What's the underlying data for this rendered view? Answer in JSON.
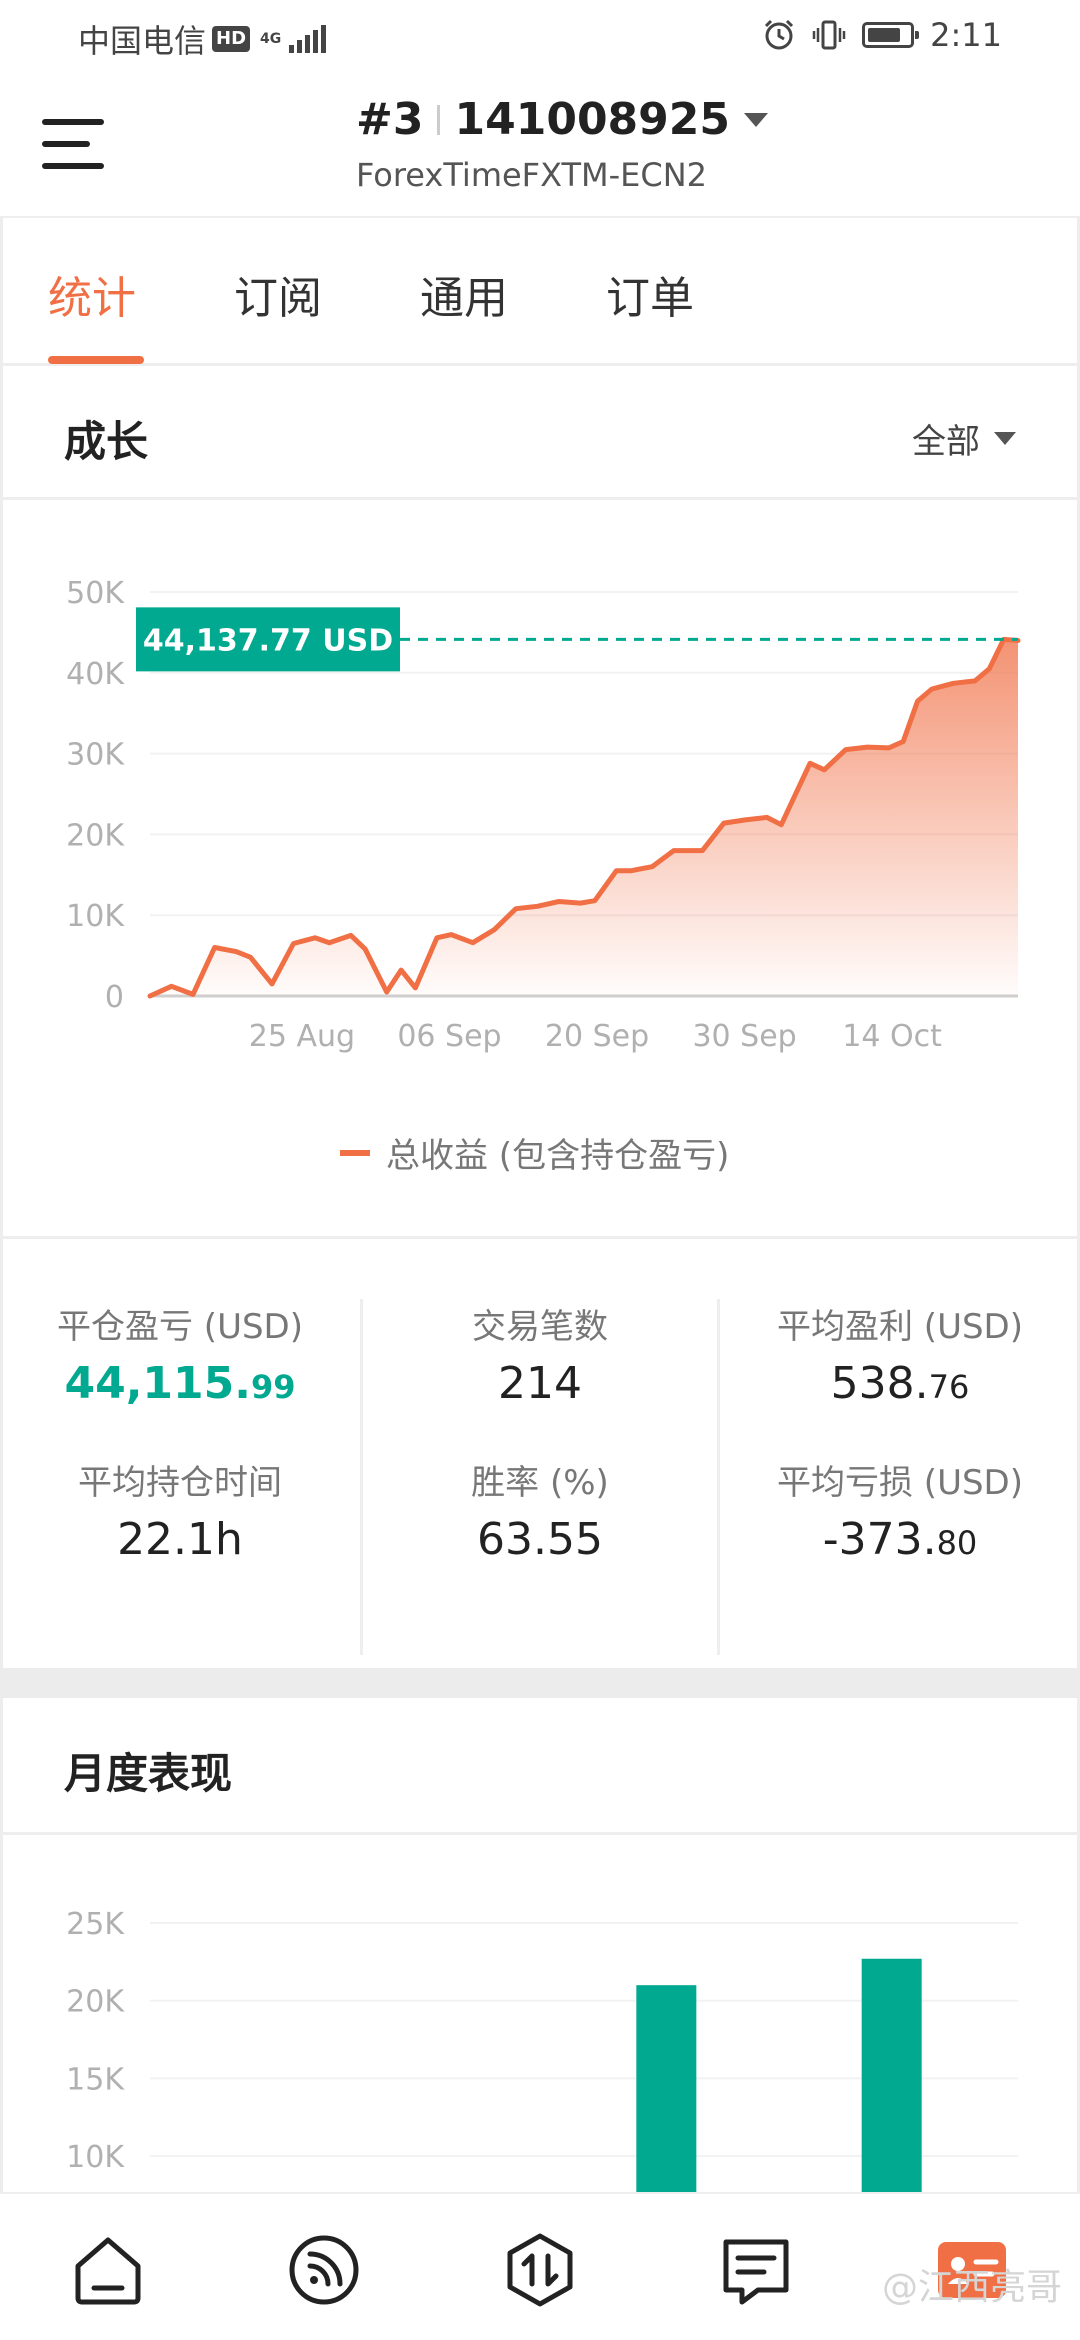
{
  "status_bar": {
    "carrier": "中国电信",
    "hd": "HD",
    "net": "4G",
    "time": "2:11",
    "battery_level": 0.8,
    "icons": [
      "alarm-icon",
      "vibrate-icon",
      "battery-icon"
    ]
  },
  "header": {
    "account_number": "#3",
    "account_id": "141008925",
    "server": "ForexTimeFXTM-ECN2"
  },
  "tabs": [
    {
      "label": "统计",
      "active": true
    },
    {
      "label": "订阅",
      "active": false
    },
    {
      "label": "通用",
      "active": false
    },
    {
      "label": "订单",
      "active": false
    }
  ],
  "growth": {
    "title": "成长",
    "filter_label": "全部",
    "current_value_label": "44,137.77 USD",
    "legend_label": "总收益 (包含持仓盈亏)"
  },
  "chart_data": [
    {
      "type": "area",
      "title": "",
      "xlabel": "",
      "ylabel": "",
      "ylim": [
        0,
        50000
      ],
      "y_ticks": [
        "0",
        "10K",
        "20K",
        "30K",
        "40K",
        "50K"
      ],
      "x_ticks": [
        "25 Aug",
        "06 Sep",
        "20 Sep",
        "30 Sep",
        "14 Oct"
      ],
      "grid": true,
      "legend": "bottom-center",
      "colors": {
        "line": "#f06f45",
        "marker": "#00a98f"
      },
      "series": [
        {
          "name": "总收益 (包含持仓盈亏)",
          "points": [
            [
              0,
              0
            ],
            [
              1.5,
              1200
            ],
            [
              3,
              200
            ],
            [
              4.5,
              6000
            ],
            [
              6,
              5500
            ],
            [
              7,
              4800
            ],
            [
              8.5,
              1500
            ],
            [
              10,
              6500
            ],
            [
              11.5,
              7200
            ],
            [
              12.5,
              6600
            ],
            [
              14,
              7500
            ],
            [
              15,
              5800
            ],
            [
              16.5,
              500
            ],
            [
              17.5,
              3200
            ],
            [
              18.5,
              1000
            ],
            [
              20,
              7200
            ],
            [
              21,
              7600
            ],
            [
              22.5,
              6600
            ],
            [
              24,
              8200
            ],
            [
              25.5,
              10800
            ],
            [
              27,
              11100
            ],
            [
              28.5,
              11700
            ],
            [
              30,
              11500
            ],
            [
              31,
              11800
            ],
            [
              32.5,
              15500
            ],
            [
              33.5,
              15500
            ],
            [
              35,
              16000
            ],
            [
              36.5,
              18000
            ],
            [
              38.5,
              18000
            ],
            [
              40,
              21400
            ],
            [
              41.5,
              21800
            ],
            [
              43,
              22100
            ],
            [
              44,
              21200
            ],
            [
              45,
              25000
            ],
            [
              46,
              28800
            ],
            [
              47,
              28000
            ],
            [
              48.5,
              30500
            ],
            [
              50,
              30800
            ],
            [
              51.5,
              30700
            ],
            [
              52.5,
              31500
            ],
            [
              53.5,
              36500
            ],
            [
              54.5,
              38000
            ],
            [
              56,
              38700
            ],
            [
              57.5,
              39000
            ],
            [
              58.5,
              40500
            ],
            [
              59.5,
              44137.77
            ],
            [
              60.5,
              44000
            ]
          ]
        }
      ]
    },
    {
      "type": "bar",
      "title": "",
      "xlabel": "",
      "ylabel": "",
      "ylim": [
        7500,
        25000
      ],
      "y_ticks": [
        "10K",
        "15K",
        "20K",
        "25K"
      ],
      "categories": [
        "",
        "",
        "",
        "",
        "",
        ""
      ],
      "values": [
        0,
        0,
        0,
        21000,
        0,
        22700
      ],
      "colors": {
        "bar": "#00a98f"
      }
    }
  ],
  "stats": {
    "closed_pl": {
      "label": "平仓盈亏 (USD)",
      "int": "44,115.",
      "dec": "99"
    },
    "trades": {
      "label": "交易笔数",
      "value": "214"
    },
    "avg_profit": {
      "label": "平均盈利 (USD)",
      "int": "538.",
      "dec": "76"
    },
    "avg_hold": {
      "label": "平均持仓时间",
      "value": "22.1h"
    },
    "win_rate": {
      "label": "胜率 (%)",
      "value": "63.55"
    },
    "avg_loss": {
      "label": "平均亏损 (USD)",
      "int": "-373.",
      "dec": "80"
    }
  },
  "monthly": {
    "title": "月度表现"
  },
  "bottom_nav": {
    "items": [
      "home-icon",
      "feed-icon",
      "trade-icon",
      "messages-icon",
      "profile-icon"
    ],
    "watermark": "@江西亮哥"
  }
}
